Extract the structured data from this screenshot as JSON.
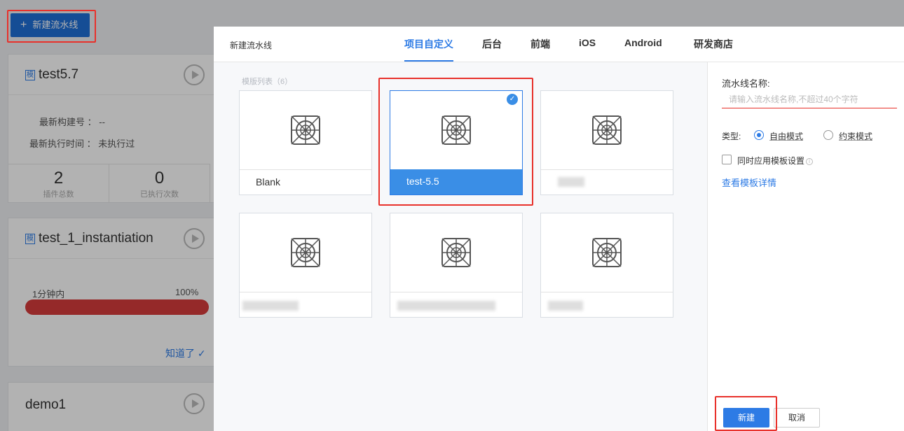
{
  "background": {
    "new_pipeline_button": "新建流水线",
    "cards": [
      {
        "title": "test5.7",
        "badge": "模",
        "latest_build_label": "最新构建号 ：",
        "latest_build_value": "--",
        "latest_exec_label": "最新执行时间 ：",
        "latest_exec_value": "未执行过",
        "stats": [
          {
            "value": "2",
            "label": "插件总数"
          },
          {
            "value": "0",
            "label": "已执行次数"
          }
        ]
      },
      {
        "title": "test_1_instantiation",
        "badge": "模",
        "progress_label": "1分钟内",
        "progress_percent": "100%",
        "progress_fraction": 1.0,
        "ack_link": "知道了"
      },
      {
        "title": "demo1"
      }
    ]
  },
  "drawer": {
    "title": "新建流水线",
    "tabs": [
      {
        "label": "项目自定义",
        "active": true
      },
      {
        "label": "后台",
        "active": false
      },
      {
        "label": "前端",
        "active": false
      },
      {
        "label": "iOS",
        "active": false
      },
      {
        "label": "Android",
        "active": false
      },
      {
        "label": "研发商店",
        "active": false
      }
    ],
    "template_list_label": "模版列表（6）",
    "templates": [
      {
        "name": "Blank",
        "selected": false
      },
      {
        "name": "test-5.5",
        "selected": true
      },
      {
        "name": "",
        "selected": false
      },
      {
        "name": "",
        "selected": false
      },
      {
        "name": "",
        "selected": false
      },
      {
        "name": "",
        "selected": false
      }
    ],
    "form": {
      "name_label": "流水线名称:",
      "name_placeholder": "请输入流水线名称,不超过40个字符",
      "type_label": "类型:",
      "type_options": [
        {
          "label": "自由模式",
          "checked": true
        },
        {
          "label": "约束模式",
          "checked": false
        }
      ],
      "apply_template_label": "同时应用模板设置",
      "apply_template_checked": false,
      "detail_link": "查看模板详情",
      "create_button": "新建",
      "cancel_button": "取消"
    },
    "colors": {
      "accent": "#2d7be5",
      "highlight_box": "#e8312b"
    }
  }
}
